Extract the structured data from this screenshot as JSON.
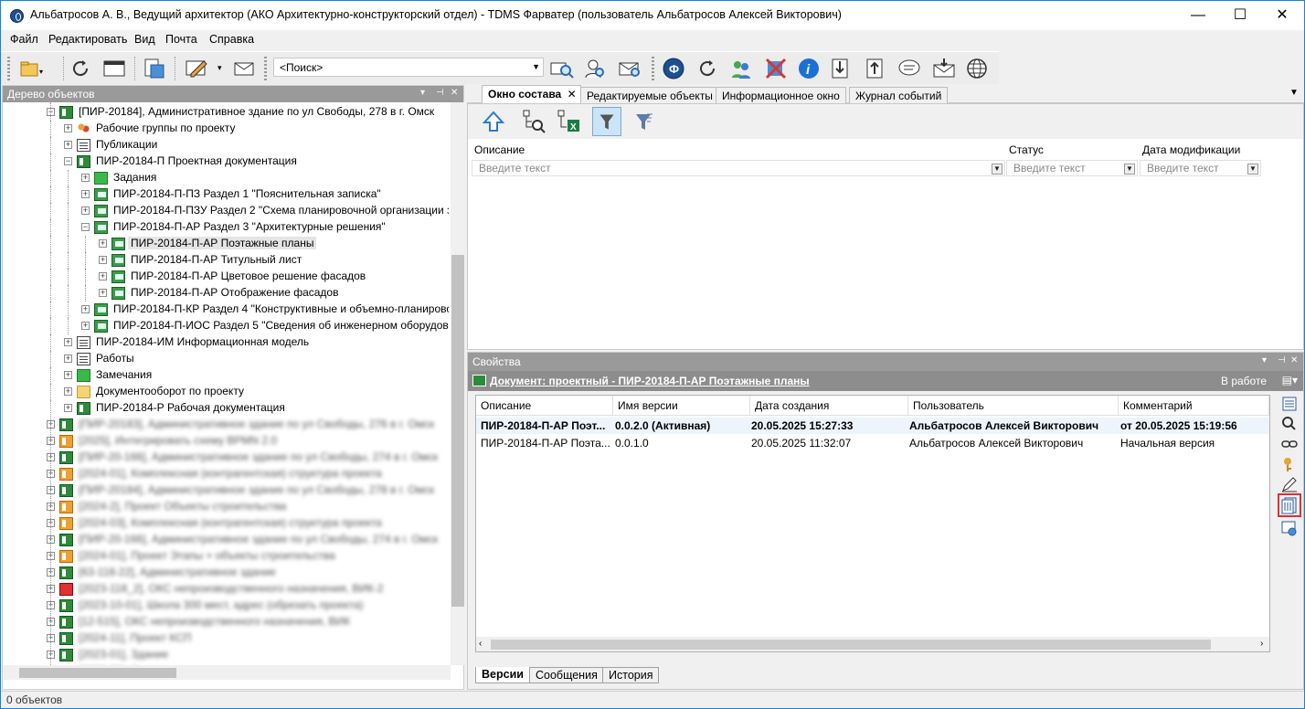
{
  "window": {
    "title": "Альбатросов А. В., Ведущий архитектор (АКО Архитектурно-конструкторский отдел) - TDMS Фарватер (пользователь Альбатросов Алексей Викторович)",
    "min": "—",
    "max": "☐",
    "close": "✕"
  },
  "menu": [
    "Файл",
    "Редактировать",
    "Вид",
    "Почта",
    "Справка"
  ],
  "search": {
    "value": "<Поиск>"
  },
  "left_panel": {
    "title": "Дерево объектов",
    "ctl_down": "▾",
    "ctl_pin": "⊣",
    "ctl_close": "✕"
  },
  "tree": [
    {
      "label": "[ПИР-20184], Административное здание по ул Свободы, 278 в г. Омск",
      "depth": 0,
      "exp": "−",
      "icon": "green"
    },
    {
      "label": "Рабочие группы по проекту",
      "depth": 1,
      "exp": "+",
      "icon": "people"
    },
    {
      "label": "Публикации",
      "depth": 1,
      "exp": "+",
      "icon": "pub"
    },
    {
      "label": "ПИР-20184-П Проектная документация",
      "depth": 1,
      "exp": "−",
      "icon": "green"
    },
    {
      "label": "Задания",
      "depth": 2,
      "exp": "+",
      "icon": "gfolder"
    },
    {
      "label": "ПИР-20184-П-ПЗ Раздел 1 \"Пояснительная записка\"",
      "depth": 2,
      "exp": "+",
      "icon": "doc"
    },
    {
      "label": "ПИР-20184-П-ПЗУ Раздел 2 \"Схема планировочной организации з",
      "depth": 2,
      "exp": "+",
      "icon": "doc"
    },
    {
      "label": "ПИР-20184-П-АР Раздел 3 \"Архитектурные решения\"",
      "depth": 2,
      "exp": "−",
      "icon": "doc"
    },
    {
      "label": "ПИР-20184-П-АР Поэтажные планы",
      "depth": 3,
      "exp": "+",
      "icon": "doc",
      "selected": true
    },
    {
      "label": "ПИР-20184-П-АР Титульный лист",
      "depth": 3,
      "exp": "+",
      "icon": "doc"
    },
    {
      "label": "ПИР-20184-П-АР Цветовое решение фасадов",
      "depth": 3,
      "exp": "+",
      "icon": "doc"
    },
    {
      "label": "ПИР-20184-П-АР Отображение фасадов",
      "depth": 3,
      "exp": "+",
      "icon": "doc"
    },
    {
      "label": "ПИР-20184-П-КР Раздел 4 \"Конструктивные и объемно-планирово",
      "depth": 2,
      "exp": "+",
      "icon": "doc"
    },
    {
      "label": "ПИР-20184-П-ИОС Раздел 5 \"Сведения об инженерном оборудова",
      "depth": 2,
      "exp": "+",
      "icon": "doc"
    },
    {
      "label": "ПИР-20184-ИМ Информационная модель",
      "depth": 1,
      "exp": "+",
      "icon": "pub"
    },
    {
      "label": "Работы",
      "depth": 1,
      "exp": "+",
      "icon": "pub"
    },
    {
      "label": "Замечания",
      "depth": 1,
      "exp": "+",
      "icon": "gfolder"
    },
    {
      "label": "Документооборот по проекту",
      "depth": 1,
      "exp": "+",
      "icon": "folder"
    },
    {
      "label": "ПИР-20184-Р Рабочая документация",
      "depth": 1,
      "exp": "+",
      "icon": "green"
    },
    {
      "label": "[ПИР-20183], Административное здание по ул Свободы, 276 в г. Омск",
      "depth": 0,
      "exp": "+",
      "icon": "green",
      "blur": true
    },
    {
      "label": "[2025], Интегрировать схему BPMN 2.0",
      "depth": 0,
      "exp": "+",
      "icon": "orange",
      "blur": true
    },
    {
      "label": "[ПИР-20-166], Административное здание по ул Свободы, 274 в г. Омск",
      "depth": 0,
      "exp": "+",
      "icon": "green",
      "blur": true
    },
    {
      "label": "[2024-01], Комплексная (контрагентская) структура проекта",
      "depth": 0,
      "exp": "+",
      "icon": "orange",
      "blur": true
    },
    {
      "label": "[ПИР-20184], Административное здание по ул Свободы, 278 в г. Омск",
      "depth": 0,
      "exp": "+",
      "icon": "green",
      "blur": true
    },
    {
      "label": "[2024-2], Проект Объекты строительства",
      "depth": 0,
      "exp": "+",
      "icon": "orange",
      "blur": true
    },
    {
      "label": "[2024-03], Комплексная (контрагентская) структура проекта",
      "depth": 0,
      "exp": "+",
      "icon": "orange",
      "blur": true
    },
    {
      "label": "[ПИР-20-166], Административное здание по ул Свободы, 274 в г. Омск",
      "depth": 0,
      "exp": "+",
      "icon": "green",
      "blur": true
    },
    {
      "label": "[2024-01], Проект Этапы + объекты строительства",
      "depth": 0,
      "exp": "+",
      "icon": "orange",
      "blur": true
    },
    {
      "label": "[63-118-22], Административное здание",
      "depth": 0,
      "exp": "+",
      "icon": "green",
      "blur": true
    },
    {
      "label": "[2023-118_2], ОКС непроизводственного назначения, ВИК-2",
      "depth": 0,
      "exp": "+",
      "icon": "red",
      "blur": true
    },
    {
      "label": "[2023-10-01], Школа 300 мест, адрес (обрезать проекта)",
      "depth": 0,
      "exp": "+",
      "icon": "green",
      "blur": true
    },
    {
      "label": "[12-515], ОКС непроизводственного назначения, ВИК",
      "depth": 0,
      "exp": "+",
      "icon": "green",
      "blur": true
    },
    {
      "label": "[2024-11], Проект КСП",
      "depth": 0,
      "exp": "+",
      "icon": "green",
      "blur": true
    },
    {
      "label": "[2023-01], Здание",
      "depth": 0,
      "exp": "+",
      "icon": "green",
      "blur": true
    },
    {
      "label": "[2023-02], Здание",
      "depth": 0,
      "exp": "+",
      "icon": "green",
      "blur": true
    }
  ],
  "tabs": [
    {
      "label": "Окно состава",
      "close": "✕",
      "active": true
    },
    {
      "label": "Редактируемые объекты"
    },
    {
      "label": "Информационное окно"
    },
    {
      "label": "Журнал событий"
    }
  ],
  "filters": {
    "cols": [
      "Описание",
      "Статус",
      "Дата модификации"
    ],
    "placeholder": "Введите текст"
  },
  "props": {
    "title": "Свойства",
    "doc_title": "Документ: проектный - ПИР-20184-П-АР Поэтажные планы",
    "state": "В работе",
    "columns": [
      "Описание",
      "Имя версии",
      "Дата создания",
      "Пользователь",
      "Комментарий"
    ],
    "rows": [
      [
        "ПИР-20184-П-АР Поэт...",
        "0.0.2.0 (Активная)",
        "20.05.2025 15:27:33",
        "Альбатросов Алексей Викторович",
        "от 20.05.2025 15:19:56"
      ],
      [
        "ПИР-20184-П-АР Поэта...",
        "0.0.1.0",
        "20.05.2025 11:32:07",
        "Альбатросов Алексей Викторович",
        "Начальная версия"
      ]
    ],
    "bottom_tabs": [
      "Версии",
      "Сообщения",
      "История"
    ]
  },
  "status": "0 объектов",
  "colors": {
    "accent": "#1883d7",
    "panel_header": "#9a9a9a",
    "highlight_box": "#e03030"
  }
}
